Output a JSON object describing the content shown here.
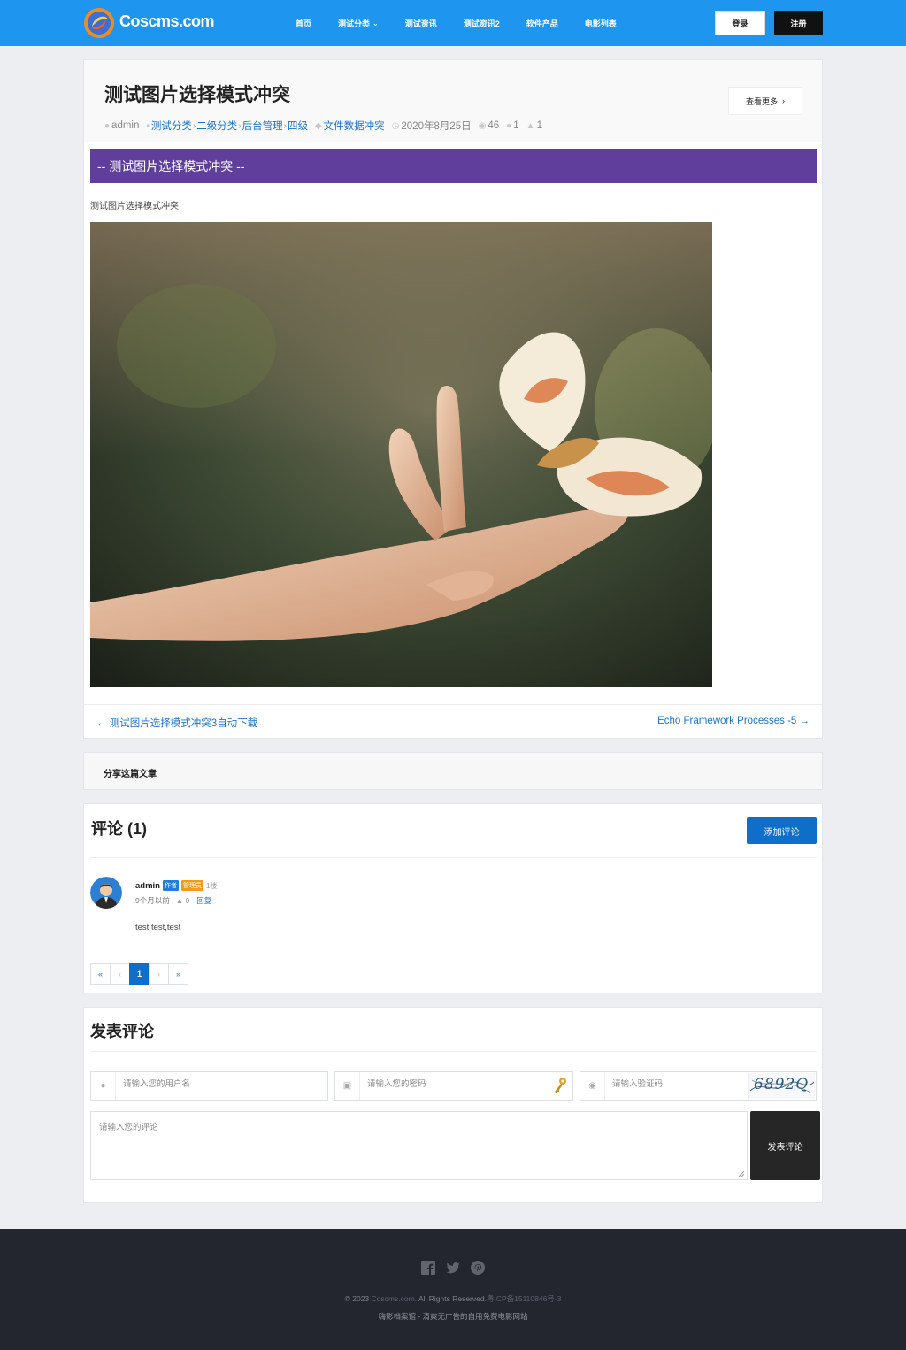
{
  "header": {
    "brand": "Coscms.com",
    "nav": [
      {
        "label": "首页",
        "has_dropdown": false
      },
      {
        "label": "测试分类",
        "has_dropdown": true
      },
      {
        "label": "测试资讯",
        "has_dropdown": false
      },
      {
        "label": "测试资讯2",
        "has_dropdown": false
      },
      {
        "label": "软件产品",
        "has_dropdown": false
      },
      {
        "label": "电影列表",
        "has_dropdown": false
      }
    ],
    "login_label": "登录",
    "register_label": "注册",
    "accent": "#1e96f0"
  },
  "article": {
    "title": "测试图片选择模式冲突",
    "more_label": "查看更多",
    "author": "admin",
    "categories": [
      "测试分类",
      "二级分类",
      "后台管理",
      "四级"
    ],
    "tag": "文件数据冲突",
    "date": "2020年8月25日",
    "views": "46",
    "comments": "1",
    "likes": "1",
    "banner": "-- 测试图片选择模式冲突 --",
    "banner_color": "#5f3f9b",
    "intro": "测试图片选择模式冲突",
    "prev_link": "测试图片选择模式冲突3自动下载",
    "next_link": "Echo Framework Processes -5"
  },
  "share": {
    "title": "分享这篇文章"
  },
  "comments": {
    "title": "评论 (1)",
    "add_label": "添加评论",
    "items": [
      {
        "user": "admin",
        "badge_author": "作者",
        "badge_admin": "管理员",
        "floor": "1楼",
        "time": "9个月以前",
        "likes": "0",
        "reply": "回复",
        "text": "test,test,test"
      }
    ],
    "pager": {
      "first": "«",
      "prev": "‹",
      "current": "1",
      "next": "›",
      "last": "»"
    }
  },
  "post": {
    "title": "发表评论",
    "username_placeholder": "请输入您的用户名",
    "password_placeholder": "请输入您的密码",
    "captcha_placeholder": "请输入验证码",
    "captcha_text": "6892Q",
    "comment_placeholder": "请输入您的评论",
    "submit_label": "发表评论"
  },
  "footer": {
    "social": [
      "facebook-icon",
      "twitter-icon",
      "pinterest-icon"
    ],
    "copyright_prefix": "© 2023",
    "copyright_site": "Coscms.com.",
    "copyright_rest": "All Rights Reserved.",
    "icp": "粤ICP备15110846号-3",
    "tagline": "嗨影档案馆 - 清爽无广告的自用免费电影网站"
  }
}
